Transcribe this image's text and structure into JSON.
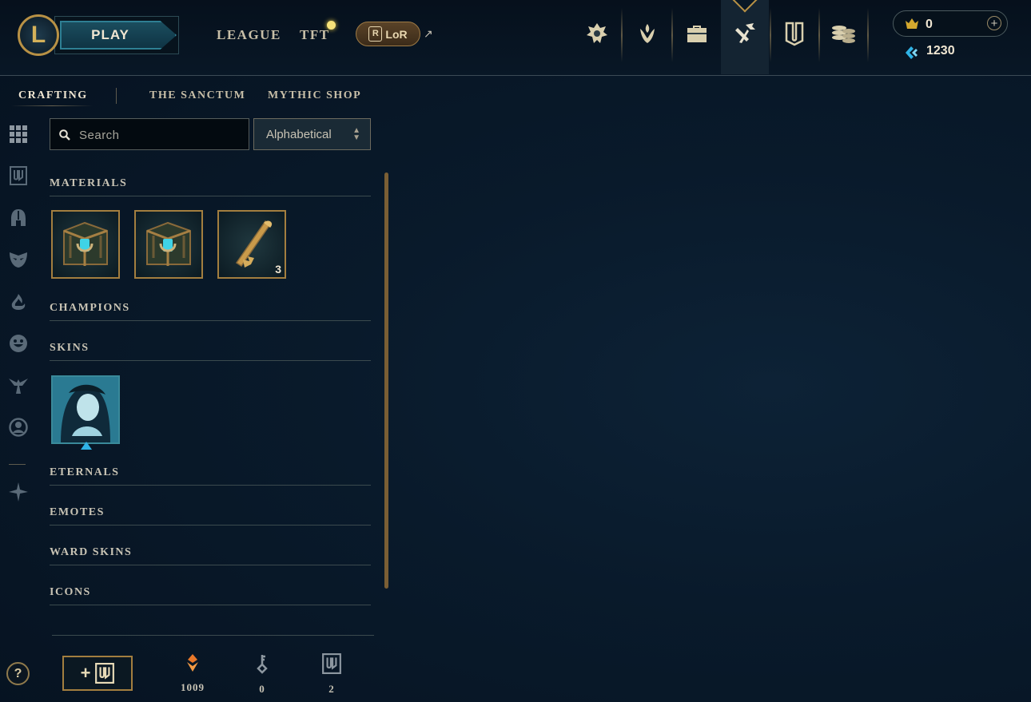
{
  "header": {
    "logo": "L",
    "play_label": "PLAY",
    "nav": {
      "league": "LEAGUE",
      "tft": "TFT",
      "lor": "LoR",
      "lor_external": "↗"
    },
    "nav_icons": [
      "home-icon",
      "profile-icon",
      "collection-icon",
      "loot-icon",
      "missions-icon",
      "store-icon"
    ],
    "active_nav": "loot-icon",
    "wallet": {
      "rp_value": "0",
      "be_value": "1230",
      "add_symbol": "+"
    }
  },
  "tabs": {
    "crafting": "CRAFTING",
    "sanctum": "THE SANCTUM",
    "mythic_shop": "MYTHIC SHOP"
  },
  "filters": {
    "rail_icons": [
      "all-icon",
      "chests-icon",
      "champions-icon",
      "skins-icon",
      "eternals-icon",
      "emotes-icon",
      "ward-skins-icon",
      "icons-icon",
      "other-icon"
    ],
    "search_placeholder": "Search",
    "sort_value": "Alphabetical"
  },
  "sections": {
    "materials": {
      "title": "MATERIALS",
      "items": [
        {
          "icon": "hextech-chest-icon",
          "count": ""
        },
        {
          "icon": "hextech-chest-icon",
          "count": ""
        },
        {
          "icon": "hextech-key-icon",
          "count": "3"
        }
      ]
    },
    "champions": {
      "title": "CHAMPIONS"
    },
    "skins": {
      "title": "SKINS",
      "items": [
        {
          "icon": "skin-shard-icon"
        }
      ]
    },
    "eternals": {
      "title": "ETERNALS"
    },
    "emotes": {
      "title": "EMOTES"
    },
    "ward_skins": {
      "title": "WARD SKINS"
    },
    "icons": {
      "title": "ICONS"
    }
  },
  "footer": {
    "add_chest_symbol": "+",
    "orange_essence": "1009",
    "key_fragments": "0",
    "chests": "2"
  },
  "help_label": "?",
  "colors": {
    "gold": "#a37e3f",
    "blue_essence": "#2fb3e6",
    "orange_essence": "#e8782a",
    "background": "#091a2b"
  }
}
